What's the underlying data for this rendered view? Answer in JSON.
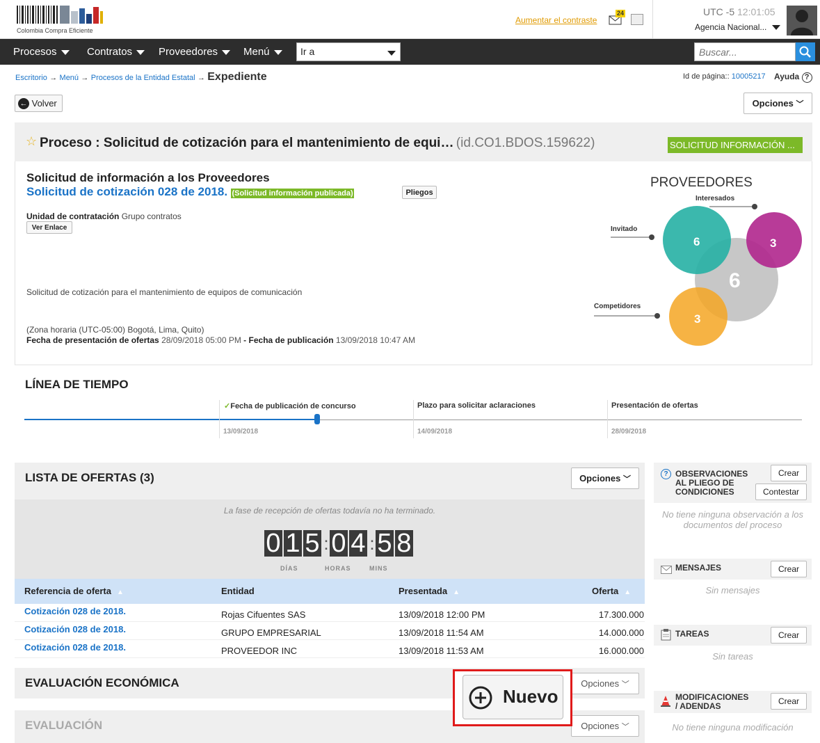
{
  "header": {
    "logo_text": "Colombia Compra Eficiente",
    "contrast_link": "Aumentar el contraste",
    "mail_count": "24",
    "timezone": "UTC -5",
    "time": "12:01:05",
    "agency": "Agencia Nacional..."
  },
  "nav": {
    "items": [
      {
        "label": "Procesos"
      },
      {
        "label": "Contratos"
      },
      {
        "label": "Proveedores"
      },
      {
        "label": "Menú"
      }
    ],
    "goto_value": "Ir a",
    "search_placeholder": "Buscar..."
  },
  "breadcrumb": {
    "items": [
      "Escritorio",
      "Menú",
      "Procesos de la Entidad Estatal"
    ],
    "current": "Expediente",
    "arrow": "→",
    "page_id_label": "Id de página::",
    "page_id": "10005217",
    "help": "Ayuda"
  },
  "toolbar": {
    "back": "Volver",
    "options": "Opciones"
  },
  "process": {
    "title": "Proceso : Solicitud de cotización para el mantenimiento de equi…",
    "id": "(id.CO1.BDOS.159622)",
    "status_badge": "SOLICITUD INFORMACIÓN ...",
    "subtitle": "Solicitud de información a los Proveedores",
    "name": "Solicitud de cotización 028 de 2018.",
    "name_badge": "(Solicitud información publicada)",
    "pliegos": "Pliegos",
    "unit_label": "Unidad de contratación",
    "unit_value": "Grupo contratos",
    "link_btn": "Ver Enlace",
    "description": "Solicitud de cotización para el mantenimiento de equipos de comunicación",
    "tz_note": "(Zona horaria (UTC-05:00) Bogotá, Lima, Quito)",
    "offer_date_label": "Fecha de presentación de ofertas",
    "offer_date": "28/09/2018 05:00 PM",
    "dash": " - ",
    "pub_date_label": "Fecha de publicación",
    "pub_date": "13/09/2018 10:47 AM"
  },
  "providers": {
    "title": "PROVEEDORES",
    "labels": {
      "interested": "Interesados",
      "invited": "Invitado",
      "competitors": "Competidores"
    },
    "invited_count": "6",
    "interested_count": "3",
    "total_count": "6",
    "competitors_count": "3",
    "colors": {
      "invited": "#26b0a4",
      "interested": "#b0268d",
      "total": "#bdbdbd",
      "competitors": "#f5a623"
    }
  },
  "timeline": {
    "title": "LÍNEA DE TIEMPO",
    "check": "✓",
    "steps": [
      {
        "label": "Fecha de publicación de concurso",
        "date": "13/09/2018"
      },
      {
        "label": "Plazo para solicitar aclaraciones",
        "date": "14/09/2018"
      },
      {
        "label": "Presentación de ofertas",
        "date": "28/09/2018"
      }
    ]
  },
  "offers": {
    "title": "LISTA DE OFERTAS (3)",
    "options": "Opciones",
    "notice": "La fase de recepción de ofertas todavía no ha terminado.",
    "countdown": {
      "days": [
        "0",
        "1",
        "5"
      ],
      "hours": [
        "0",
        "4"
      ],
      "mins": [
        "5",
        "8"
      ],
      "sep": ":",
      "labels": [
        "DÍAS",
        "HORAS",
        "MINS"
      ]
    },
    "columns": [
      "Referencia de oferta",
      "Entidad",
      "Presentada",
      "Oferta"
    ],
    "rows": [
      {
        "ref": "Cotización 028 de 2018.",
        "entity": "Rojas Cifuentes SAS",
        "date": "13/09/2018 12:00 PM",
        "amount": "17.300.000"
      },
      {
        "ref": "Cotización 028 de 2018.",
        "entity": "GRUPO EMPRESARIAL",
        "date": "13/09/2018 11:54 AM",
        "amount": "14.000.000"
      },
      {
        "ref": "Cotización 028 de 2018.",
        "entity": "PROVEEDOR INC",
        "date": "13/09/2018 11:53 AM",
        "amount": "16.000.000"
      }
    ]
  },
  "economic": {
    "title": "EVALUACIÓN ECONÓMICA",
    "options": "Opciones",
    "new_button": "Nuevo"
  },
  "evaluation": {
    "title": "EVALUACIÓN",
    "options": "Opciones"
  },
  "sidebar": {
    "observations": {
      "title": "OBSERVACIONES AL PLIEGO DE CONDICIONES",
      "create": "Crear",
      "reply": "Contestar",
      "empty": "No tiene ninguna observación a los documentos del proceso"
    },
    "messages": {
      "title": "MENSAJES",
      "create": "Crear",
      "empty": "Sin mensajes"
    },
    "tasks": {
      "title": "TAREAS",
      "create": "Crear",
      "empty": "Sin tareas"
    },
    "amendments": {
      "title": "MODIFICACIONES / ADENDAS",
      "create": "Crear",
      "empty": "No tiene ninguna modificación"
    }
  }
}
